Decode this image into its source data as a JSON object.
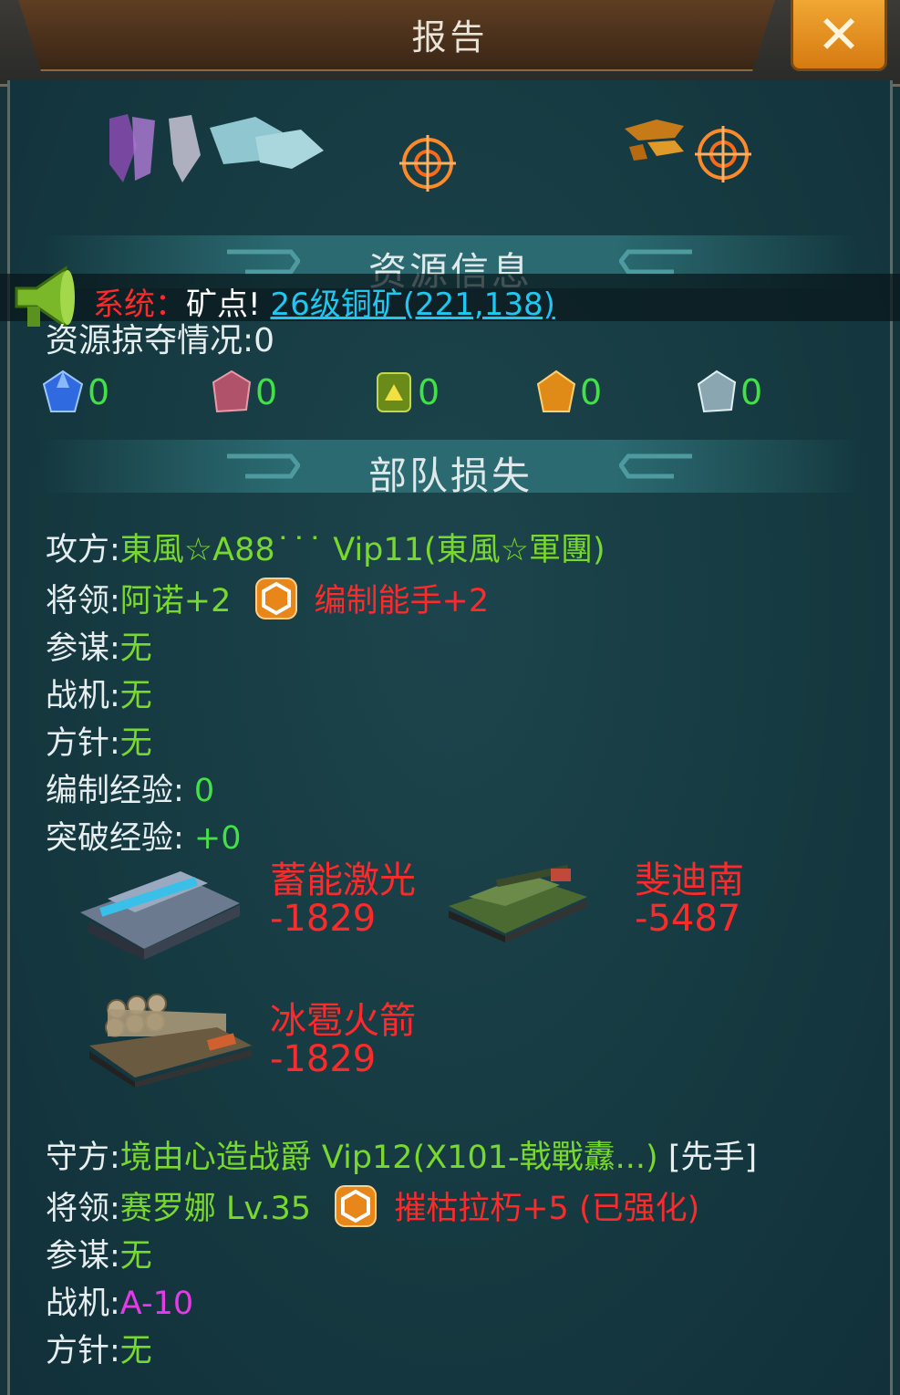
{
  "window": {
    "title": "报告",
    "close_icon": "close-icon"
  },
  "resource_section": {
    "title": "资源信息"
  },
  "broadcast": {
    "sender": "系统：",
    "message": "矿点!",
    "link": "26级铜矿(221,138)"
  },
  "loot": {
    "label": "资源掠夺情况:",
    "value": "0"
  },
  "resources": [
    {
      "icon": "blue-gem-icon",
      "value": "0"
    },
    {
      "icon": "red-ore-icon",
      "value": "0"
    },
    {
      "icon": "oil-barrel-icon",
      "value": "0"
    },
    {
      "icon": "gold-ore-icon",
      "value": "0"
    },
    {
      "icon": "steel-ore-icon",
      "value": "0"
    }
  ],
  "troop_section": {
    "title": "部队损失"
  },
  "attacker": {
    "label": "攻方:",
    "name": "東風☆A88˙˙˙ Vip11(東風☆軍團)",
    "general_label": "将领:",
    "general": "阿诺+2",
    "skill": "编制能手+2",
    "staff_label": "参谋:",
    "staff": "无",
    "aircraft_label": "战机:",
    "aircraft": "无",
    "policy_label": "方针:",
    "policy": "无",
    "org_exp_label": "编制经验:",
    "org_exp": " 0",
    "break_exp_label": "突破经验:",
    "break_exp": " +0",
    "units": [
      {
        "name": "蓄能激光",
        "loss": "-1829"
      },
      {
        "name": "斐迪南",
        "loss": "-5487"
      },
      {
        "name": "冰雹火箭",
        "loss": "-1829"
      }
    ]
  },
  "defender": {
    "label": "守方:",
    "name": "境由心造战爵 Vip12",
    "legion": "(X101-戟戰纛...)",
    "tag": " [先手]",
    "general_label": "将领:",
    "general": "赛罗娜 Lv.35",
    "skill": "摧枯拉朽+5 (已强化)",
    "staff_label": "参谋:",
    "staff": "无",
    "aircraft_label": "战机:",
    "aircraft": "A-10",
    "policy_label": "方针:",
    "policy": "无"
  },
  "colors": {
    "positive": "#44e04a",
    "name_green": "#78d82e",
    "loss_red": "#ff2a2a",
    "link_cyan": "#1ec8f0",
    "aircraft_magenta": "#e63ae6",
    "close_orange": "#e8921f"
  }
}
